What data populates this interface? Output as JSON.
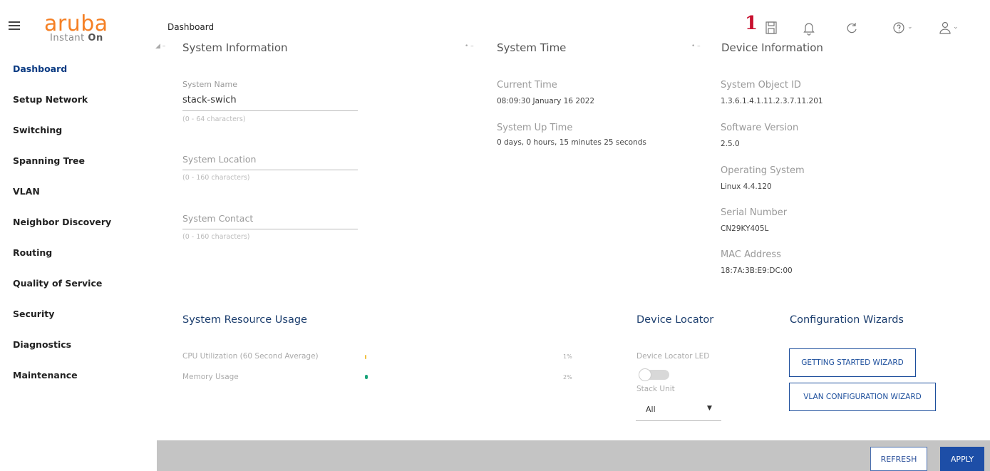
{
  "app": {
    "brand": "aruba",
    "brand_sub_prefix": "Instant ",
    "brand_sub_suffix": "On",
    "annotation_marker": "1"
  },
  "header": {
    "title": "Dashboard",
    "icons": [
      "save-icon",
      "bell-icon",
      "refresh-icon",
      "help-icon",
      "user-icon"
    ]
  },
  "sidebar": {
    "items": [
      {
        "label": "Dashboard",
        "active": true
      },
      {
        "label": "Setup Network"
      },
      {
        "label": "Switching"
      },
      {
        "label": "Spanning Tree"
      },
      {
        "label": "VLAN"
      },
      {
        "label": "Neighbor Discovery"
      },
      {
        "label": "Routing"
      },
      {
        "label": "Quality of Service"
      },
      {
        "label": "Security"
      },
      {
        "label": "Diagnostics"
      },
      {
        "label": "Maintenance"
      }
    ]
  },
  "system_information": {
    "heading": "System Information",
    "name_label": "System Name",
    "name_value": "stack-swich",
    "name_hint": "(0 - 64 characters)",
    "location_label": "System Location",
    "location_hint": "(0 - 160 characters)",
    "contact_label": "System Contact",
    "contact_hint": "(0 - 160 characters)"
  },
  "system_time": {
    "heading": "System Time",
    "current_label": "Current Time",
    "current_value": "08:09:30 January 16 2022",
    "uptime_label": "System Up Time",
    "uptime_value": "0 days, 0 hours, 15 minutes 25 seconds"
  },
  "device_information": {
    "heading": "Device Information",
    "oid_label": "System Object ID",
    "oid_value": "1.3.6.1.4.1.11.2.3.7.11.201",
    "sw_label": "Software Version",
    "sw_value": "2.5.0",
    "os_label": "Operating System",
    "os_value": "Linux 4.4.120",
    "serial_label": "Serial Number",
    "serial_value": "CN29KY405L",
    "mac_label": "MAC Address",
    "mac_value": "18:7A:3B:E9:DC:00"
  },
  "resource_usage": {
    "heading": "System Resource Usage",
    "cpu_label": "CPU Utilization (60 Second Average)",
    "cpu_pct": "1%",
    "mem_label": "Memory Usage",
    "mem_pct": "2%",
    "bar_color": "#1aa37a"
  },
  "device_locator": {
    "heading": "Device Locator",
    "led_label": "Device Locator LED",
    "led_on": false,
    "stack_label": "Stack Unit",
    "stack_value": "All"
  },
  "wizards": {
    "heading": "Configuration Wizards",
    "getting_started": "GETTING STARTED WIZARD",
    "vlan": "VLAN CONFIGURATION WIZARD"
  },
  "footer": {
    "refresh_label": "REFRESH",
    "apply_label": "APPLY"
  },
  "colors": {
    "brand_orange": "#f58025",
    "primary_blue": "#1d4ea7",
    "annotation_red": "#c8102e"
  }
}
